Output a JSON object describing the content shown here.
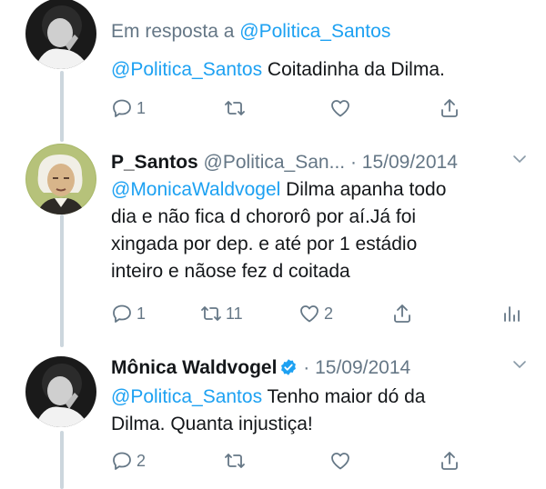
{
  "tweets": [
    {
      "reply_prefix": "Em resposta a",
      "reply_handle": "@Politica_Santos",
      "mention": "@Politica_Santos",
      "text": " Coitadinha da Dilma.",
      "replies": "1",
      "retweets": "",
      "likes": ""
    },
    {
      "name": "P_Santos",
      "handle": "@Politica_San...",
      "dot": "·",
      "date": "15/09/2014",
      "mention": "@MonicaWaldvogel",
      "text_lines": [
        " Dilma apanha todo",
        "dia e não fica d chororô por aí.Já foi",
        "xingada por dep. e até por 1 estádio",
        "inteiro e nãose fez d coitada"
      ],
      "replies": "1",
      "retweets": "11",
      "likes": "2"
    },
    {
      "name": "Mônica Waldvogel",
      "dot": "·",
      "date": "15/09/2014",
      "mention": "@Politica_Santos",
      "text_lines": [
        " Tenho maior dó da",
        "Dilma. Quanta injustiça!"
      ],
      "replies": "2",
      "retweets": "",
      "likes": ""
    }
  ],
  "icons": {
    "reply": "reply-icon",
    "retweet": "retweet-icon",
    "like": "heart-icon",
    "share": "share-icon",
    "analytics": "analytics-icon",
    "caret": "chevron-down-icon",
    "verified": "verified-badge-icon"
  },
  "colors": {
    "link": "#1da1f2",
    "secondary": "#657786",
    "text": "#14171a",
    "thread_line": "#ccd6dd"
  }
}
